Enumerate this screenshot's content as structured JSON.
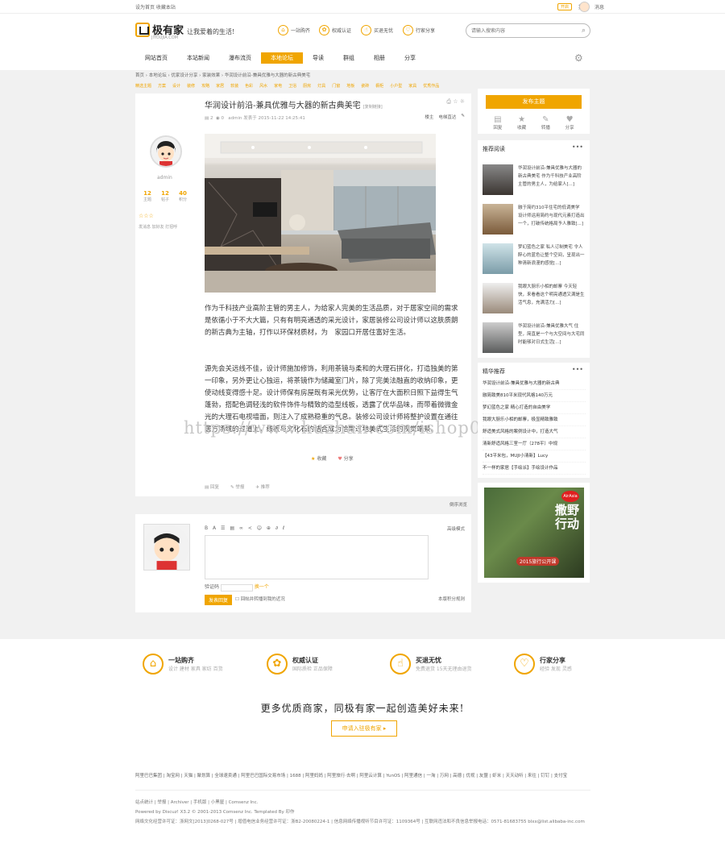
{
  "topbar": {
    "left_text": "设为首页 收藏本站",
    "badge": "开启",
    "links": [
      "提醒",
      "消息"
    ]
  },
  "header": {
    "logo_text": "极有家",
    "logo_sub": "JIYOUJIA.COM",
    "slogan": "让我爱着的生活!",
    "features": [
      {
        "label": "一站购齐",
        "icon": "cart-icon"
      },
      {
        "label": "权威认证",
        "icon": "badge-icon"
      },
      {
        "label": "买退无忧",
        "icon": "thumb-icon"
      },
      {
        "label": "行家分享",
        "icon": "share-icon"
      }
    ],
    "search_placeholder": "请输入搜索内容"
  },
  "nav": [
    "网站首页",
    "本站新闻",
    "瀑布流页",
    "本地论坛",
    "导读",
    "群组",
    "相册",
    "分享"
  ],
  "nav_active": 3,
  "breadcrumb": "首页 › 本地论坛 › 优家设计分享 › 家装效果 › 华润设计前沿-兼具优雅与大器的新古典美宅",
  "subnav": [
    "精选主题",
    "方案",
    "设计",
    "装修",
    "攻略",
    "家居",
    "软装",
    "色彩",
    "风水",
    "家电",
    "卫浴",
    "厨房",
    "灯具",
    "门窗",
    "地板",
    "瓷砖",
    "橱柜",
    "小户型",
    "家具",
    "优秀作品"
  ],
  "post": {
    "title": "华润设计前沿-兼具优雅与大器的新古典美宅",
    "title_tag": "[复制链接]",
    "meta": {
      "replies": "2",
      "views": "0",
      "author_line": "admin 发表于 2015-11-22 14:25:41"
    },
    "actions": [
      "楼主",
      "电梯直达"
    ],
    "author": {
      "name": "admin",
      "stats": [
        {
          "value": "12",
          "label": "主题"
        },
        {
          "value": "12",
          "label": "帖子"
        },
        {
          "value": "40",
          "label": "积分"
        }
      ],
      "medals": "☆☆☆",
      "links": "发消息 加好友 打招呼"
    },
    "paragraphs": [
      "作为千科技产业高阶主管的男主人，为给家人完美的生活品质，对于居家空间的需求是依循小于不大大篇，只有有明亮通透的采光设计，家居装修公司设计师以这肤质朗的新古典为主轴，打作以环保材质材，为　家园口开居住富好生活。",
      "源先会关远线不佳，设计师施加修饰，利用茶镜与柔和的大理石拼化，打造独美的第一印象，另外更让心独运，将茶镜作为储藏室门片，除了完美法融直的收纳印象，更使动线变得感十足。设计师保有房屋既有采光优势，让客厅在大面积日照下益得生气蓬勃，搭配色调轻浅的软件饰件与精致的造型线板，透露了优华品味，而带着微微金光的大理石电视墙面，则注入了成熟稳重的气息。装修公司设计师将整护设置在通往居方场域的过道上，线板与文化石的结合成为恰常过地美式生活的视觉端景。"
    ],
    "fav_btns": [
      "收藏",
      "分享"
    ],
    "footer_actions": [
      "回复",
      "举报",
      "推荐"
    ],
    "watermark": "https://www.huzhan.com/ishop0002"
  },
  "reply_bar": "倒序浏览",
  "reply": {
    "toolbar": "B A ☰ ▤ ∞ ≺ ☺ ⊕ ∂ ℓ",
    "advanced": "高级模式",
    "code_label": "验证码",
    "code_link": "换一个",
    "submit": "发表回复",
    "check": "回帖并转播到我的近况",
    "rules": "本版积分规则"
  },
  "sidebar": {
    "publish": "发布主题",
    "buttons": [
      {
        "label": "回复",
        "icon": "reply-icon"
      },
      {
        "label": "收藏",
        "icon": "star-icon"
      },
      {
        "label": "转播",
        "icon": "pencil-icon"
      },
      {
        "label": "分享",
        "icon": "share-icon"
      }
    ],
    "rec_title": "推荐阅读",
    "recs": [
      "华润设计前沿-兼具优雅与大器的新古典美宅 作为千科技产业高阶主管的男主人，为给家人[...]",
      "融于简约310平住宅的低调美学 设计师运用简约与现代元素打造出一个，打破传统格局予人雅致[...]",
      "梦幻蓝色之家 私人订制美宅 令人醉心的蓝色让整个空间，呈现出一种清新浪漫的感觉[...]",
      "我眼大厨乐小相的邮寨 今天轻快，来看看这个明亮通透又满是生活气息，充满活力[...]",
      "华润设计前沿-兼具优雅大气 住型，简直是一个与大空间与大宅同时能够对日式生活[...]"
    ],
    "hot_title": "精华推荐",
    "hot": [
      "华润设计前沿-兼具优雅与大器的新古典",
      "融简致美810平米现代风格140万元",
      "梦幻蓝色之家 精心打造的自由美学",
      "我眼大厨乐小相的邮寨，极显精致雅致",
      "舒适美式风格的案例设计中，打造大气",
      "清新舒适风格三室一厅（278平）中规",
      "【43平米包，MUJI小清新】Lucy",
      "不一样的家居【手绘派】手绘设计作品"
    ],
    "ad_text": [
      "撒野",
      "行动"
    ],
    "ad_banner": "2015旅行公开课",
    "ad_brand": "AirAsia"
  },
  "footer": {
    "features": [
      {
        "title": "一站购齐",
        "sub": "设计 建材 家具 家纺 百货",
        "icon": "cart-icon"
      },
      {
        "title": "权威认证",
        "sub": "国际质检 正品保障",
        "icon": "badge-icon"
      },
      {
        "title": "买退无忧",
        "sub": "免费退货 15天无理由退货",
        "icon": "thumb-icon"
      },
      {
        "title": "行家分享",
        "sub": "经验 发现 灵感",
        "icon": "share-icon"
      }
    ],
    "slogan": "更多优质商家，同极有家一起创造美好未来!",
    "apply_btn": "申请入驻极有家 ▸",
    "links": "阿里巴巴集团 | 淘宝网 | 天猫 | 聚划算 | 全球速卖通 | 阿里巴巴国际交易市场 | 1688 | 阿里妈妈 | 阿里旅行·去啊 | 阿里云计算 | YunOS | 阿里通信 | 一淘 | 万网 | 高德 | 优视 | 友盟 | 虾米 | 天天动听 | 来往 | 钉钉 | 支付宝",
    "copy": [
      "站点统计 | 举报 | Archiver | 手机版 | 小黑屋 | Comsenz Inc.",
      "Powered by Discuz! X3.2 © 2001-2013 Comsenz Inc. Templated By 印作",
      "网络文化经营许可证：浙网文[2013]0268-027号 | 增值电信业务经营许可证：浙B2-20080224-1 | 信息网络传播视听节目许可证：1109364号 | 互联网违法和不良信息举报电话：0571-81683755 blxx@list.alibaba-inc.com"
    ]
  },
  "colors": {
    "accent": "#f0a500",
    "text": "#333333"
  }
}
